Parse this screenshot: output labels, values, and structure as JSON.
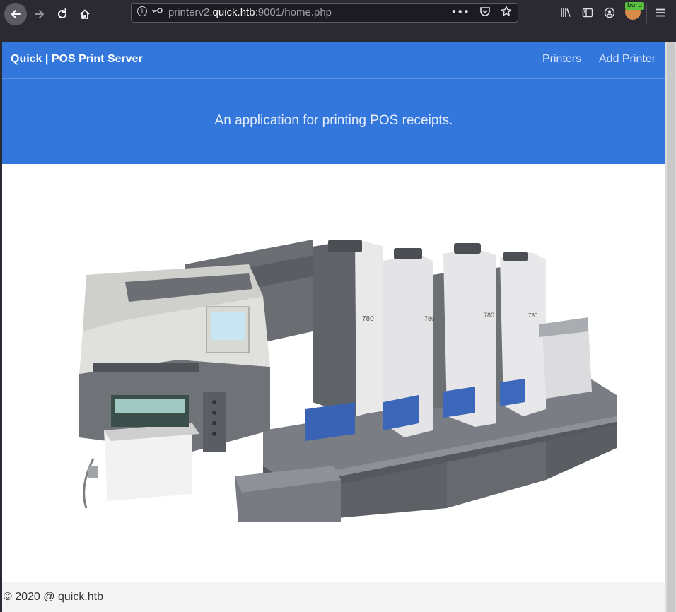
{
  "browser": {
    "back_icon": "arrow-left-icon",
    "forward_icon": "arrow-right-icon",
    "reload_icon": "reload-icon",
    "home_icon": "home-icon",
    "url": {
      "prefix": "printerv2.",
      "host": "quick.htb",
      "suffix": ":9001/home.php"
    },
    "burp_badge": "burp"
  },
  "page": {
    "brand": "Quick | POS Print Server",
    "nav": {
      "printers": "Printers",
      "add_printer": "Add Printer"
    },
    "hero_text": "An application for printing POS receipts.",
    "machine_model": "780",
    "footer_text": "© 2020 @ quick.htb"
  },
  "colors": {
    "primary": "#3477dc",
    "browser_chrome": "#2b2a33",
    "footer_bg": "#f4f4f4"
  }
}
